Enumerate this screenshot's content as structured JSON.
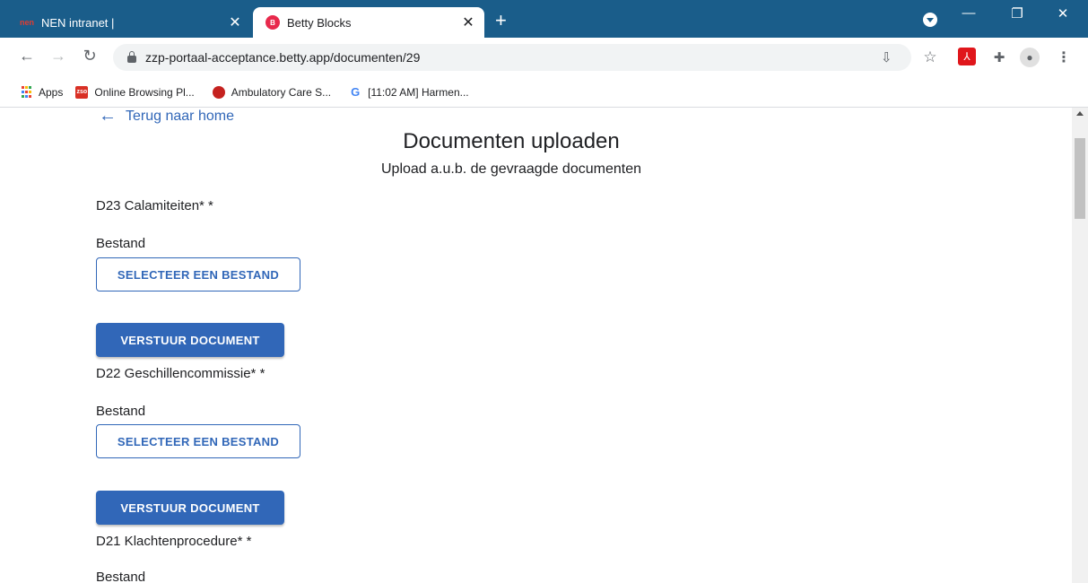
{
  "browser": {
    "tabs": [
      {
        "title": "NEN intranet |",
        "favicon": "nen-logo",
        "active": false
      },
      {
        "title": "Betty Blocks",
        "favicon": "betty-blocks-logo",
        "active": true
      }
    ],
    "url": "zzp-portaal-acceptance.betty.app/documenten/29",
    "bookmarks": [
      {
        "label": "Apps",
        "icon": "apps-grid-icon"
      },
      {
        "label": "Online Browsing Pl...",
        "icon": "zso-icon"
      },
      {
        "label": "Ambulatory Care S...",
        "icon": "red-circle-icon"
      },
      {
        "label": "[11:02 AM] Harmen...",
        "icon": "google-icon"
      }
    ],
    "colors": {
      "tabbar": "#1a5d8a"
    }
  },
  "page": {
    "back_link": "Terug naar home",
    "title": "Documenten uploaden",
    "subtitle": "Upload a.u.b. de gevraagde documenten",
    "documents": [
      {
        "name": "D23 Calamiteiten* *",
        "file_label": "Bestand",
        "select_label": "SELECTEER EEN BESTAND",
        "send_label": "VERSTUUR DOCUMENT"
      },
      {
        "name": "D22 Geschillencommissie* *",
        "file_label": "Bestand",
        "select_label": "SELECTEER EEN BESTAND",
        "send_label": "VERSTUUR DOCUMENT"
      },
      {
        "name": "D21 Klachtenprocedure* *",
        "file_label": "Bestand"
      }
    ],
    "colors": {
      "primary": "#3167b8"
    }
  }
}
